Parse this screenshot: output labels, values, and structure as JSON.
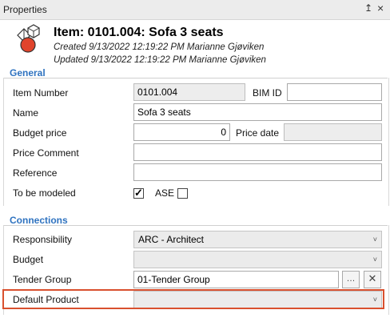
{
  "panel": {
    "title": "Properties",
    "pin_glyph": "↥",
    "close_glyph": "×"
  },
  "item": {
    "title": "Item: 0101.004: Sofa 3 seats",
    "created": "Created 9/13/2022 12:19:22 PM Marianne Gjøviken",
    "updated": "Updated 9/13/2022 12:19:22 PM Marianne Gjøviken",
    "icon": "item-shapes-icon"
  },
  "general": {
    "heading": "General",
    "item_number_label": "Item Number",
    "item_number_value": "0101.004",
    "bim_id_label": "BIM ID",
    "bim_id_value": "",
    "name_label": "Name",
    "name_value": "Sofa 3 seats",
    "budget_price_label": "Budget price",
    "budget_price_value": "0",
    "price_date_label": "Price date",
    "price_date_value": "",
    "price_comment_label": "Price Comment",
    "price_comment_value": "",
    "reference_label": "Reference",
    "reference_value": "",
    "to_be_modeled_label": "To be modeled",
    "to_be_modeled_checked": true,
    "check_glyph": "✓",
    "ase_label": "ASE",
    "ase_checked": false
  },
  "connections": {
    "heading": "Connections",
    "responsibility_label": "Responsibility",
    "responsibility_value": "ARC - Architect",
    "budget_label": "Budget",
    "budget_value": "",
    "tender_group_label": "Tender Group",
    "tender_group_value": "01-Tender Group",
    "browse_glyph": "…",
    "clear_glyph": "✕",
    "default_product_label": "Default Product",
    "default_product_value": "",
    "dropdown_glyph": "˅"
  },
  "colors": {
    "accent": "#2f73c0",
    "highlight": "#d9502e",
    "icon_red": "#e0442c"
  }
}
